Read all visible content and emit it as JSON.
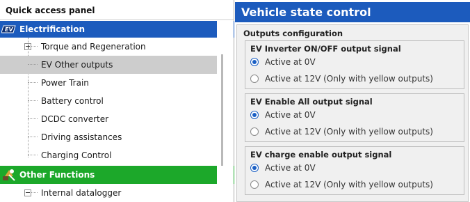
{
  "quick_access": {
    "title": "Quick access panel",
    "sections": [
      {
        "label": "Electrification",
        "icon": "ev-electrification-icon",
        "color": "#1c5bbd",
        "items": [
          {
            "label": "Torque and Regeneration",
            "expandable": true,
            "selected": false
          },
          {
            "label": "EV Other outputs",
            "expandable": false,
            "selected": true
          },
          {
            "label": "Power Train",
            "expandable": false,
            "selected": false
          },
          {
            "label": "Battery control",
            "expandable": false,
            "selected": false
          },
          {
            "label": "DCDC converter",
            "expandable": false,
            "selected": false
          },
          {
            "label": "Driving assistances",
            "expandable": false,
            "selected": false
          },
          {
            "label": "Charging Control",
            "expandable": false,
            "selected": false
          }
        ]
      },
      {
        "label": "Other Functions",
        "icon": "other-functions-icon",
        "color": "#1ca82a",
        "items": [
          {
            "label": "Internal datalogger",
            "expandable": true,
            "expanded": true,
            "selected": false
          }
        ]
      }
    ]
  },
  "vehicle_state": {
    "title": "Vehicle state control",
    "outputs_title": "Outputs configuration",
    "groups": [
      {
        "title": "EV Inverter ON/OFF output signal",
        "options": [
          {
            "label": "Active at 0V",
            "checked": true
          },
          {
            "label": "Active at 12V (Only with yellow outputs)",
            "checked": false
          }
        ]
      },
      {
        "title": "EV Enable All output signal",
        "options": [
          {
            "label": "Active at 0V",
            "checked": true
          },
          {
            "label": "Active at 12V (Only with yellow outputs)",
            "checked": false
          }
        ]
      },
      {
        "title": "EV charge enable output signal",
        "options": [
          {
            "label": "Active at 0V",
            "checked": true
          },
          {
            "label": "Active at 12V (Only with yellow outputs)",
            "checked": false
          }
        ]
      }
    ]
  },
  "colors": {
    "header_blue": "#1c5bbd",
    "section_green": "#1ca82a",
    "selected_row": "#cdcdcd",
    "radio_accent": "#1a5fc4"
  }
}
